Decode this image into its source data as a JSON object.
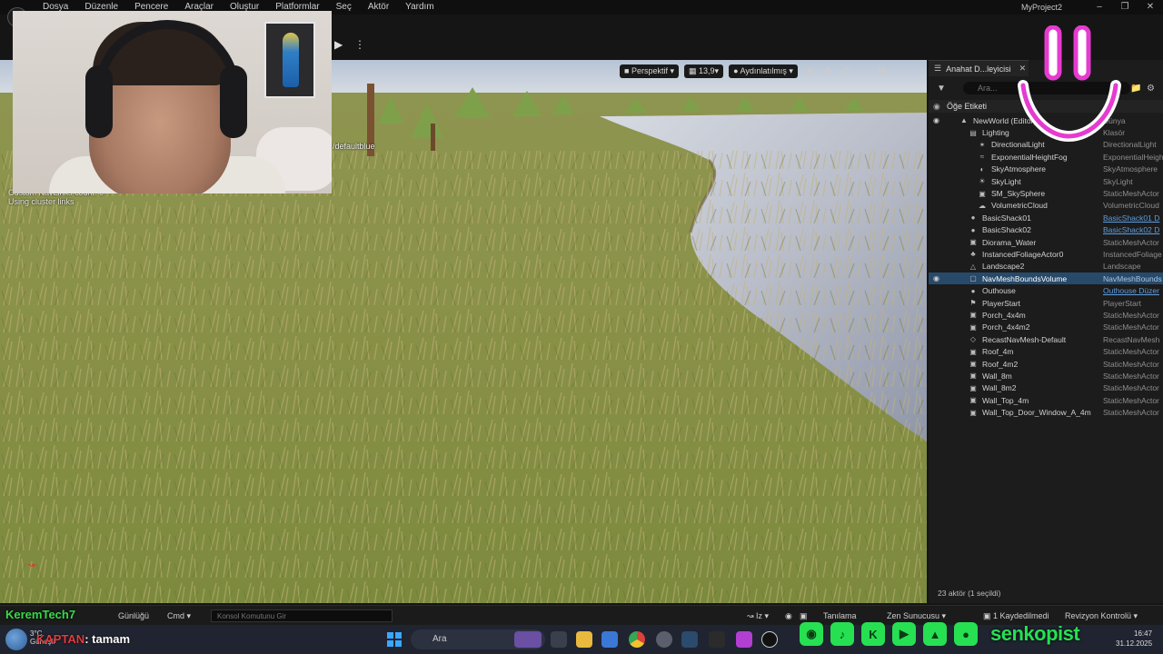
{
  "menu": {
    "items": [
      "Dosya",
      "Düzenle",
      "Pencere",
      "Araçlar",
      "Oluştur",
      "Platformlar",
      "Seç",
      "Aktör",
      "Yardım"
    ],
    "project_name": "MyProject2"
  },
  "viewport": {
    "perspective_label": "Perspektif",
    "fov_value": "13,9",
    "lighting_label": "Aydınlatılmış",
    "debug_lines": [
      "Custom NavLinks count: 0",
      "Using cluster links"
    ],
    "default_tag": "/defaultblue"
  },
  "outliner": {
    "tab_label": "Anahat D...leyicisi",
    "search_placeholder": "Ara...",
    "header_label": "Öğe Etiketi",
    "rows": [
      {
        "name": "NewWorld (Editor)",
        "type": "Dünya",
        "icon": "world-icon",
        "indent": 2,
        "link": false,
        "selected": false,
        "eye": true
      },
      {
        "name": "Lighting",
        "type": "Klasör",
        "icon": "folder-icon",
        "indent": 3,
        "link": false,
        "selected": false,
        "eye": false
      },
      {
        "name": "DirectionalLight",
        "type": "DirectionalLight",
        "icon": "light-icon",
        "indent": 4,
        "link": false,
        "selected": false,
        "eye": false
      },
      {
        "name": "ExponentialHeightFog",
        "type": "ExponentialHeigh",
        "icon": "fog-icon",
        "indent": 4,
        "link": false,
        "selected": false,
        "eye": false
      },
      {
        "name": "SkyAtmosphere",
        "type": "SkyAtmosphere",
        "icon": "sky-icon",
        "indent": 4,
        "link": false,
        "selected": false,
        "eye": false
      },
      {
        "name": "SkyLight",
        "type": "SkyLight",
        "icon": "skylight-icon",
        "indent": 4,
        "link": false,
        "selected": false,
        "eye": false
      },
      {
        "name": "SM_SkySphere",
        "type": "StaticMeshActor",
        "icon": "mesh-icon",
        "indent": 4,
        "link": false,
        "selected": false,
        "eye": false
      },
      {
        "name": "VolumetricCloud",
        "type": "VolumetricCloud",
        "icon": "cloud-icon",
        "indent": 4,
        "link": false,
        "selected": false,
        "eye": false
      },
      {
        "name": "BasicShack01",
        "type": "BasicShack01 D",
        "icon": "actor-icon",
        "indent": 3,
        "link": true,
        "selected": false,
        "eye": false
      },
      {
        "name": "BasicShack02",
        "type": "BasicShack02 D",
        "icon": "actor-icon",
        "indent": 3,
        "link": true,
        "selected": false,
        "eye": false
      },
      {
        "name": "Diorama_Water",
        "type": "StaticMeshActor",
        "icon": "mesh-icon",
        "indent": 3,
        "link": false,
        "selected": false,
        "eye": false
      },
      {
        "name": "InstancedFoliageActor0",
        "type": "InstancedFoliage",
        "icon": "foliage-icon",
        "indent": 3,
        "link": false,
        "selected": false,
        "eye": false
      },
      {
        "name": "Landscape2",
        "type": "Landscape",
        "icon": "landscape-icon",
        "indent": 3,
        "link": false,
        "selected": false,
        "eye": false
      },
      {
        "name": "NavMeshBoundsVolume",
        "type": "NavMeshBounds",
        "icon": "volume-icon",
        "indent": 3,
        "link": false,
        "selected": true,
        "eye": true
      },
      {
        "name": "Outhouse",
        "type": "Outhouse Düzer",
        "icon": "actor-icon",
        "indent": 3,
        "link": true,
        "selected": false,
        "eye": false
      },
      {
        "name": "PlayerStart",
        "type": "PlayerStart",
        "icon": "player-icon",
        "indent": 3,
        "link": false,
        "selected": false,
        "eye": false
      },
      {
        "name": "Porch_4x4m",
        "type": "StaticMeshActor",
        "icon": "mesh-icon",
        "indent": 3,
        "link": false,
        "selected": false,
        "eye": false
      },
      {
        "name": "Porch_4x4m2",
        "type": "StaticMeshActor",
        "icon": "mesh-icon",
        "indent": 3,
        "link": false,
        "selected": false,
        "eye": false
      },
      {
        "name": "RecastNavMesh-Default",
        "type": "RecastNavMesh",
        "icon": "navmesh-icon",
        "indent": 3,
        "link": false,
        "selected": false,
        "eye": false
      },
      {
        "name": "Roof_4m",
        "type": "StaticMeshActor",
        "icon": "mesh-icon",
        "indent": 3,
        "link": false,
        "selected": false,
        "eye": false
      },
      {
        "name": "Roof_4m2",
        "type": "StaticMeshActor",
        "icon": "mesh-icon",
        "indent": 3,
        "link": false,
        "selected": false,
        "eye": false
      },
      {
        "name": "Wall_8m",
        "type": "StaticMeshActor",
        "icon": "mesh-icon",
        "indent": 3,
        "link": false,
        "selected": false,
        "eye": false
      },
      {
        "name": "Wall_8m2",
        "type": "StaticMeshActor",
        "icon": "mesh-icon",
        "indent": 3,
        "link": false,
        "selected": false,
        "eye": false
      },
      {
        "name": "Wall_Top_4m",
        "type": "StaticMeshActor",
        "icon": "mesh-icon",
        "indent": 3,
        "link": false,
        "selected": false,
        "eye": false
      },
      {
        "name": "Wall_Top_Door_Window_A_4m",
        "type": "StaticMeshActor",
        "icon": "mesh-icon",
        "indent": 3,
        "link": false,
        "selected": false,
        "eye": false
      }
    ],
    "footer": "23 aktör (1 seçildi)"
  },
  "statusbar": {
    "channel_name": "KeremTech7",
    "log_label": "Günlüğü",
    "cmd_label": "Cmd",
    "console_placeholder": "Konsol Komutunu Gir",
    "derived_label": "Tanılama",
    "zen_label": "Zen Sunucusu",
    "unsaved_label": "1 Kaydedilmedi",
    "revision_label": "Revizyon Kontrolü"
  },
  "taskbar": {
    "temperature": "3°C",
    "weather_desc": "Güneşli",
    "chat_user": "KAPTAN",
    "chat_message": ": tamam",
    "search_label": "Ara",
    "time": "16:47",
    "date": "31.12.2025"
  },
  "social": {
    "handle": "senkopist",
    "icons": [
      "instagram-icon",
      "tiktok-icon",
      "kick-icon",
      "youtube-icon",
      "like-icon",
      "bell-icon"
    ]
  },
  "colors": {
    "accent_green": "#26e052",
    "selection_blue": "#274a6b",
    "smiley_pink": "#e63bd0",
    "link_blue": "#5d9de0"
  }
}
